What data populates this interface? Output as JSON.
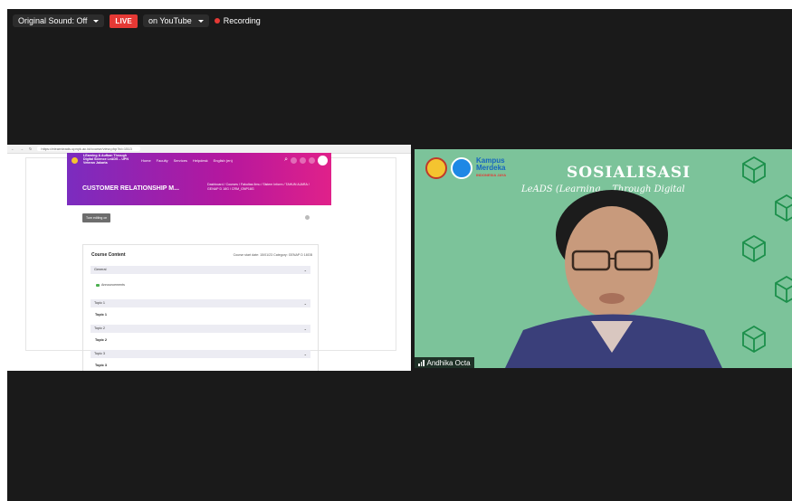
{
  "topbar": {
    "original_sound": "Original Sound: Off",
    "live_label": "LIVE",
    "stream_target": "on YouTube",
    "recording": "Recording"
  },
  "shared_screen": {
    "url": "https://elearnleads.upnyk.ac.id/course/view.php?id=1513",
    "site_brand": "LEarning & Aufban Through Digital Science LeADS – UPN Veteran Jakarta",
    "nav": [
      "Home",
      "Faculty",
      "Services",
      "Helpdesk",
      "English (en)"
    ],
    "course_title": "CUSTOMER RELATIONSHIP M...",
    "breadcrumb": "Dashboard / Courses / Fakultas Ilmu / Sistem Inform / TAHUN AJARA / GENAP D 18G / CRM_GNP18G",
    "turn_editing": "Turn editing on",
    "course_content": {
      "heading": "Course Content",
      "meta": "Course start date: 15/01/23   Category: GENAP D 18GB",
      "general": "General",
      "announcements": "Announcements",
      "topics": [
        {
          "row": "Topic 1",
          "label": "Topic 1"
        },
        {
          "row": "Topic 2",
          "label": "Topic 2"
        },
        {
          "row": "Topic 3",
          "label": "Topic 3"
        }
      ]
    }
  },
  "webcam": {
    "title": "SOSIALISASI",
    "subtitle": "LeADS (Learning... Through Digital",
    "kampus_line1": "Kampus",
    "kampus_line2": "Merdeka",
    "kampus_line3": "INDONESIA JAYA",
    "participant_name": "Andhika Octa",
    "background_color": "#7cc39a"
  }
}
